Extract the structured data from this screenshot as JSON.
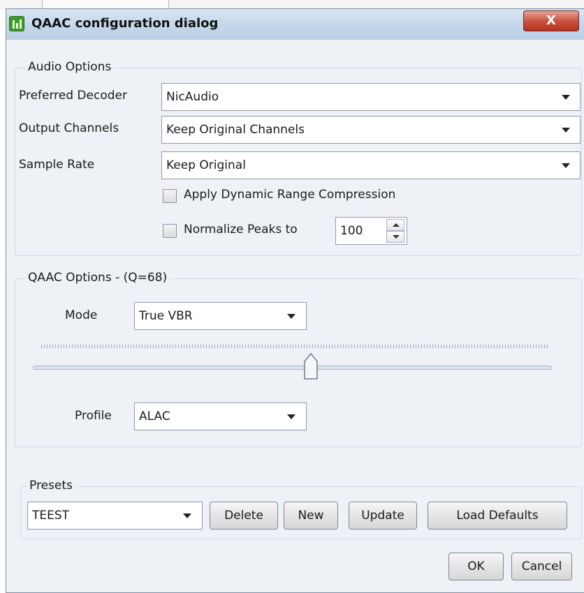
{
  "window": {
    "title": "QAAC configuration dialog",
    "close_label": "X"
  },
  "audio_options": {
    "legend": "Audio Options",
    "preferred_decoder": {
      "label": "Preferred Decoder",
      "value": "NicAudio"
    },
    "output_channels": {
      "label": "Output Channels",
      "value": "Keep Original Channels"
    },
    "sample_rate": {
      "label": "Sample Rate",
      "value": "Keep Original"
    },
    "drc": {
      "label": "Apply Dynamic Range Compression",
      "checked": false
    },
    "normalize": {
      "label": "Normalize Peaks to",
      "checked": false,
      "value": "100"
    }
  },
  "qaac_options": {
    "legend": "QAAC Options - (Q=68)",
    "mode": {
      "label": "Mode",
      "value": "True VBR"
    },
    "quality_slider": {
      "value": 68,
      "min": 0,
      "max": 127
    },
    "profile": {
      "label": "Profile",
      "value": "ALAC"
    }
  },
  "presets": {
    "legend": "Presets",
    "selected": "TEEST",
    "delete_label": "Delete",
    "new_label": "New",
    "update_label": "Update",
    "load_defaults_label": "Load Defaults"
  },
  "footer": {
    "ok_label": "OK",
    "cancel_label": "Cancel"
  },
  "icons": {
    "app": "app-icon",
    "dropdown": "chevron-down-icon"
  },
  "colors": {
    "titlebar": "#c4d6ea",
    "close": "#c9543f",
    "app_icon": "#3f9a2c"
  }
}
